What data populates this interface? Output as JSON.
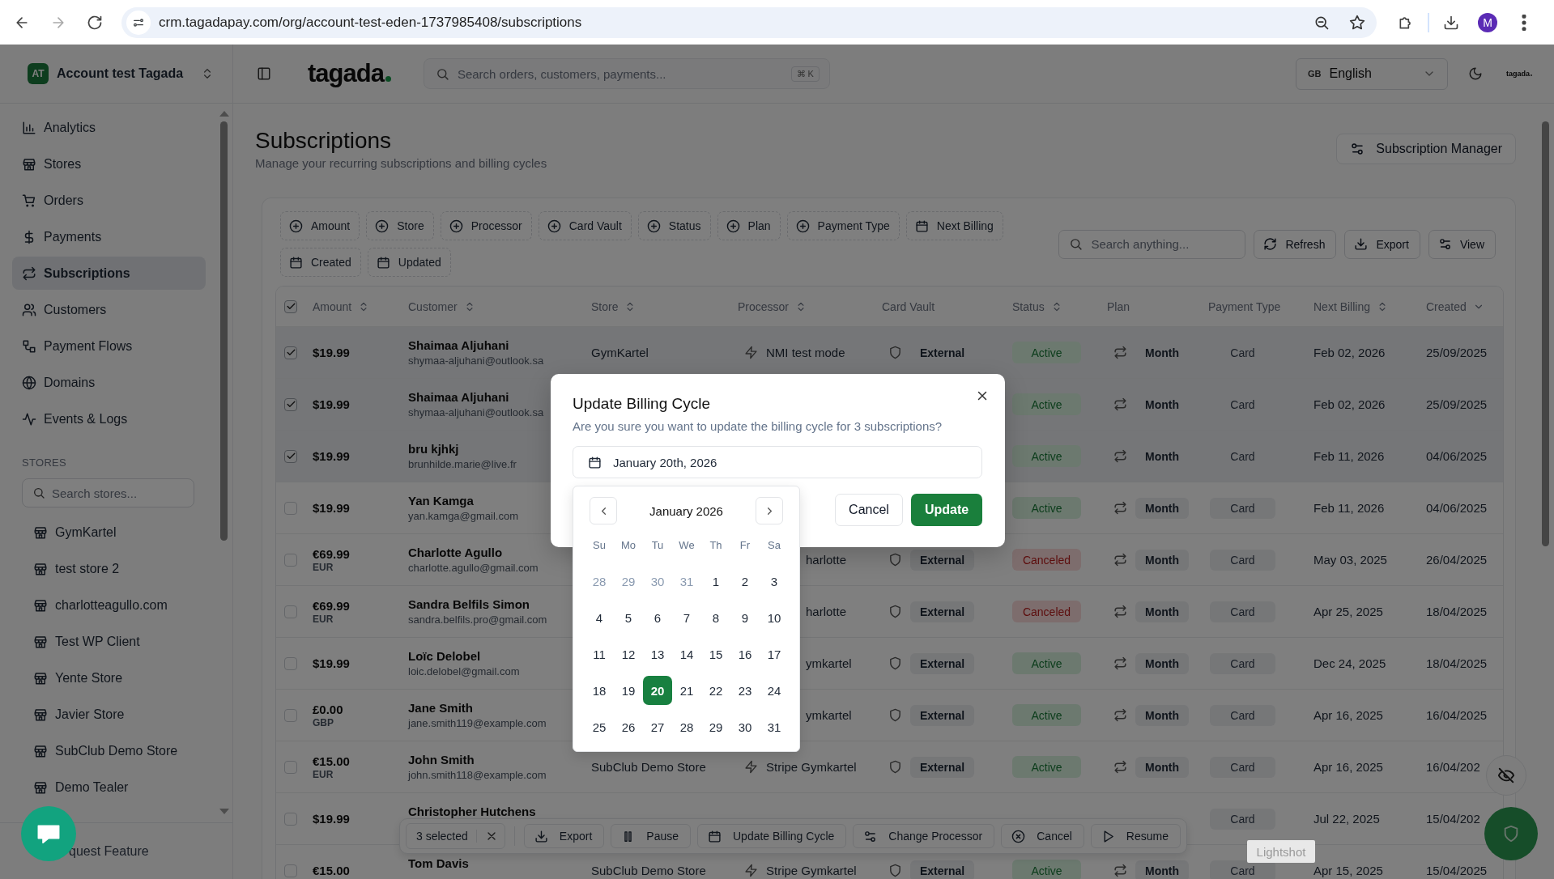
{
  "browser": {
    "url": "crm.tagadapay.com/org/account-test-eden-1737985408/subscriptions",
    "profile": "M"
  },
  "account": {
    "initials": "AT",
    "name": "Account test Tagada"
  },
  "header": {
    "logo": "tagada",
    "search_placeholder": "Search orders, customers, payments...",
    "shortcut": "⌘ K",
    "language": {
      "code": "GB",
      "label": "English"
    },
    "small_logo": "tagada"
  },
  "sidebar": {
    "items": [
      {
        "label": "Analytics",
        "selected": false
      },
      {
        "label": "Stores",
        "selected": false
      },
      {
        "label": "Orders",
        "selected": false
      },
      {
        "label": "Payments",
        "selected": false
      },
      {
        "label": "Subscriptions",
        "selected": true
      },
      {
        "label": "Customers",
        "selected": false
      },
      {
        "label": "Payment Flows",
        "selected": false
      },
      {
        "label": "Domains",
        "selected": false
      },
      {
        "label": "Events & Logs",
        "selected": false
      }
    ],
    "stores_heading": "STORES",
    "stores_search_placeholder": "Search stores...",
    "stores": [
      "GymKartel",
      "test store 2",
      "charlotteagullo.com",
      "Test WP Client",
      "Yente Store",
      "Javier Store",
      "SubClub Demo Store",
      "Demo Tealer"
    ],
    "footer_link": "quest Feature"
  },
  "page": {
    "title": "Subscriptions",
    "subtitle": "Manage your recurring subscriptions and billing cycles",
    "manager_button": "Subscription Manager"
  },
  "filters": [
    {
      "label": "Amount",
      "kind": "add"
    },
    {
      "label": "Store",
      "kind": "add"
    },
    {
      "label": "Processor",
      "kind": "add"
    },
    {
      "label": "Card Vault",
      "kind": "add"
    },
    {
      "label": "Status",
      "kind": "add"
    },
    {
      "label": "Plan",
      "kind": "add"
    },
    {
      "label": "Payment Type",
      "kind": "add"
    },
    {
      "label": "Next Billing",
      "kind": "date"
    },
    {
      "label": "Created",
      "kind": "date"
    },
    {
      "label": "Updated",
      "kind": "date"
    }
  ],
  "toolbar": {
    "search_placeholder": "Search anything...",
    "actions": [
      "Refresh",
      "Export",
      "View"
    ]
  },
  "table": {
    "select_all": true,
    "columns": [
      {
        "label": "Amount",
        "sortable": true,
        "sorted": false
      },
      {
        "label": "Customer",
        "sortable": true,
        "sorted": false
      },
      {
        "label": "Store",
        "sortable": true,
        "sorted": false
      },
      {
        "label": "Processor",
        "sortable": true,
        "sorted": false
      },
      {
        "label": "Card Vault",
        "sortable": false,
        "sorted": false
      },
      {
        "label": "Status",
        "sortable": true,
        "sorted": false
      },
      {
        "label": "Plan",
        "sortable": false,
        "sorted": false
      },
      {
        "label": "Payment Type",
        "sortable": false,
        "sorted": false
      },
      {
        "label": "Next Billing",
        "sortable": true,
        "sorted": false
      },
      {
        "label": "Created",
        "sortable": true,
        "sorted": true
      }
    ],
    "rows": [
      {
        "selected": true,
        "amount": "$19.99",
        "name": "Shaimaa Aljuhani",
        "email": "shymaa-aljuhani@outlook.sa",
        "store": "GymKartel",
        "processor": {
          "name": "NMI test mode",
          "kind": "full"
        },
        "vault": "External",
        "status": {
          "text": "Active",
          "kind": "active"
        },
        "plan": "Month",
        "payment_type": "Card",
        "next_billing": "Feb 02, 2026",
        "created": "25/09/2025"
      },
      {
        "selected": true,
        "amount": "$19.99",
        "name": "Shaimaa Aljuhani",
        "email": "shymaa-aljuhani@outlook.sa",
        "status": {
          "text": "Active",
          "kind": "active"
        },
        "plan": "Month",
        "payment_type": "Card",
        "next_billing": "Feb 02, 2026",
        "created": "25/09/2025"
      },
      {
        "selected": true,
        "amount": "$19.99",
        "name": "bru kjhkj",
        "email": "brunhilde.marie@live.fr",
        "status": {
          "text": "Active",
          "kind": "active"
        },
        "plan": "Month",
        "payment_type": "Card",
        "next_billing": "Feb 11, 2026",
        "created": "04/06/2025"
      },
      {
        "selected": false,
        "amount": "$19.99",
        "name": "Yan Kamga",
        "email": "yan.kamga@gmail.com",
        "status": {
          "text": "Active",
          "kind": "active"
        },
        "plan": "Month",
        "payment_type": "Card",
        "next_billing": "Feb 11, 2026",
        "created": "04/06/2025"
      },
      {
        "selected": false,
        "amount": "€69.99",
        "currency": "EUR",
        "name": "Charlotte Agullo",
        "email": "charlotte.agullo@gmail.com",
        "processor": {
          "name": "harlotte",
          "kind": "partial"
        },
        "vault": "External",
        "status": {
          "text": "Canceled",
          "kind": "canceled"
        },
        "plan": "Month",
        "payment_type": "Card",
        "next_billing": "May 03, 2025",
        "created": "26/04/2025"
      },
      {
        "selected": false,
        "amount": "€69.99",
        "currency": "EUR",
        "name": "Sandra Belfils Simon",
        "email": "sandra.belfils.pro@gmail.com",
        "processor": {
          "name": "harlotte",
          "kind": "partial"
        },
        "vault": "External",
        "status": {
          "text": "Canceled",
          "kind": "canceled"
        },
        "plan": "Month",
        "payment_type": "Card",
        "next_billing": "Apr 25, 2025",
        "created": "18/04/2025"
      },
      {
        "selected": false,
        "amount": "$19.99",
        "name": "Loïc Delobel",
        "email": "loic.delobel@gmail.com",
        "processor": {
          "name": "ymkartel",
          "kind": "partial"
        },
        "vault": "External",
        "status": {
          "text": "Active",
          "kind": "active"
        },
        "plan": "Month",
        "payment_type": "Card",
        "next_billing": "Dec 24, 2025",
        "created": "18/04/2025"
      },
      {
        "selected": false,
        "amount": "£0.00",
        "currency": "GBP",
        "name": "Jane Smith",
        "email": "jane.smith119@example.com",
        "processor": {
          "name": "ymkartel",
          "kind": "partial"
        },
        "vault": "External",
        "status": {
          "text": "Active",
          "kind": "active"
        },
        "plan": "Month",
        "payment_type": "Card",
        "next_billing": "Apr 16, 2025",
        "created": "16/04/2025"
      },
      {
        "selected": false,
        "amount": "€15.00",
        "currency": "EUR",
        "name": "John Smith",
        "email": "john.smith118@example.com",
        "store": "SubClub Demo Store",
        "processor": {
          "name": "Stripe Gymkartel",
          "kind": "full"
        },
        "vault": "External",
        "status": {
          "text": "Active",
          "kind": "active"
        },
        "plan": "Month",
        "payment_type": "Card",
        "next_billing": "Apr 16, 2025",
        "created": "16/04/202"
      },
      {
        "selected": false,
        "amount": "$19.99",
        "name": "Christopher Hutchens",
        "payment_type": "Card",
        "next_billing": "Jul 22, 2025",
        "created": "15/04/202"
      },
      {
        "selected": false,
        "amount": "€15.00",
        "name": "Tom Davis",
        "store": "SubClub Demo Store",
        "processor": {
          "name": "Stripe Gymkartel",
          "kind": "full"
        },
        "vault": "External",
        "status": {
          "text": "Active",
          "kind": "active"
        },
        "plan": "Month",
        "payment_type": "Card",
        "next_billing": "Apr 15, 2025",
        "created": "15/04/2025"
      }
    ]
  },
  "bulk_bar": {
    "count": "3 selected",
    "actions": [
      "Export",
      "Pause",
      "Update Billing Cycle",
      "Change Processor",
      "Cancel",
      "Resume"
    ]
  },
  "modal": {
    "title": "Update Billing Cycle",
    "description": "Are you sure you want to update the billing cycle for 3 subscriptions?",
    "date_value": "January 20th, 2026",
    "cancel": "Cancel",
    "confirm": "Update",
    "calendar": {
      "month": "January 2026",
      "weekdays": [
        "Su",
        "Mo",
        "Tu",
        "We",
        "Th",
        "Fr",
        "Sa"
      ],
      "weeks": [
        [
          {
            "day": "28",
            "outside": true,
            "selected": false
          },
          {
            "day": "29",
            "outside": true,
            "selected": false
          },
          {
            "day": "30",
            "outside": true,
            "selected": false
          },
          {
            "day": "31",
            "outside": true,
            "selected": false
          },
          {
            "day": "1",
            "outside": false,
            "selected": false
          },
          {
            "day": "2",
            "outside": false,
            "selected": false
          },
          {
            "day": "3",
            "outside": false,
            "selected": false
          }
        ],
        [
          {
            "day": "4",
            "outside": false,
            "selected": false
          },
          {
            "day": "5",
            "outside": false,
            "selected": false
          },
          {
            "day": "6",
            "outside": false,
            "selected": false
          },
          {
            "day": "7",
            "outside": false,
            "selected": false
          },
          {
            "day": "8",
            "outside": false,
            "selected": false
          },
          {
            "day": "9",
            "outside": false,
            "selected": false
          },
          {
            "day": "10",
            "outside": false,
            "selected": false
          }
        ],
        [
          {
            "day": "11",
            "outside": false,
            "selected": false
          },
          {
            "day": "12",
            "outside": false,
            "selected": false
          },
          {
            "day": "13",
            "outside": false,
            "selected": false
          },
          {
            "day": "14",
            "outside": false,
            "selected": false
          },
          {
            "day": "15",
            "outside": false,
            "selected": false
          },
          {
            "day": "16",
            "outside": false,
            "selected": false
          },
          {
            "day": "17",
            "outside": false,
            "selected": false
          }
        ],
        [
          {
            "day": "18",
            "outside": false,
            "selected": false
          },
          {
            "day": "19",
            "outside": false,
            "selected": false
          },
          {
            "day": "20",
            "outside": false,
            "selected": true
          },
          {
            "day": "21",
            "outside": false,
            "selected": false
          },
          {
            "day": "22",
            "outside": false,
            "selected": false
          },
          {
            "day": "23",
            "outside": false,
            "selected": false
          },
          {
            "day": "24",
            "outside": false,
            "selected": false
          }
        ],
        [
          {
            "day": "25",
            "outside": false,
            "selected": false
          },
          {
            "day": "26",
            "outside": false,
            "selected": false
          },
          {
            "day": "27",
            "outside": false,
            "selected": false
          },
          {
            "day": "28",
            "outside": false,
            "selected": false
          },
          {
            "day": "29",
            "outside": false,
            "selected": false
          },
          {
            "day": "30",
            "outside": false,
            "selected": false
          },
          {
            "day": "31",
            "outside": false,
            "selected": false
          }
        ]
      ]
    }
  },
  "tooltip": "Lightshot"
}
